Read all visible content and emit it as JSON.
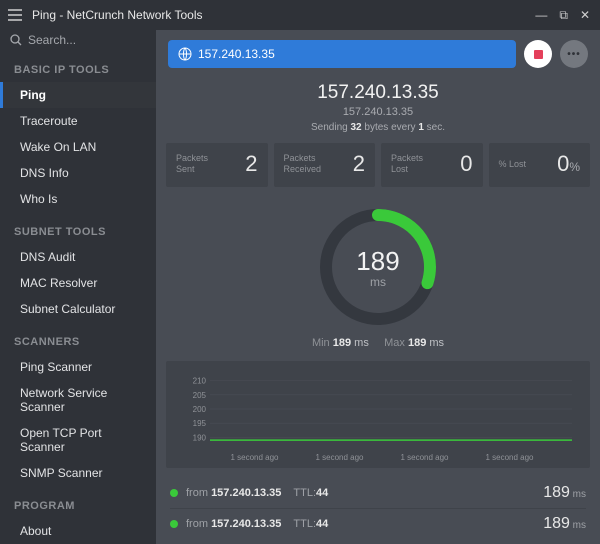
{
  "window": {
    "title": "Ping - NetCrunch Network Tools"
  },
  "search": {
    "placeholder": "Search..."
  },
  "sidebar": {
    "sections": [
      {
        "title": "BASIC IP TOOLS",
        "items": [
          {
            "label": "Ping",
            "active": true
          },
          {
            "label": "Traceroute",
            "active": false
          },
          {
            "label": "Wake On LAN",
            "active": false
          },
          {
            "label": "DNS Info",
            "active": false
          },
          {
            "label": "Who Is",
            "active": false
          }
        ]
      },
      {
        "title": "SUBNET TOOLS",
        "items": [
          {
            "label": "DNS Audit",
            "active": false
          },
          {
            "label": "MAC Resolver",
            "active": false
          },
          {
            "label": "Subnet Calculator",
            "active": false
          }
        ]
      },
      {
        "title": "SCANNERS",
        "items": [
          {
            "label": "Ping Scanner",
            "active": false
          },
          {
            "label": "Network Service Scanner",
            "active": false
          },
          {
            "label": "Open TCP Port Scanner",
            "active": false
          },
          {
            "label": "SNMP Scanner",
            "active": false
          }
        ]
      },
      {
        "title": "PROGRAM",
        "items": [
          {
            "label": "About",
            "active": false
          }
        ]
      }
    ]
  },
  "address": {
    "value": "157.240.13.35"
  },
  "header": {
    "ip_primary": "157.240.13.35",
    "ip_secondary": "157.240.13.35",
    "sending_prefix": "Sending ",
    "sending_bytes": "32",
    "sending_mid": " bytes every ",
    "sending_secs": "1",
    "sending_suffix": " sec."
  },
  "stats": {
    "sent_label": "Packets\nSent",
    "sent_value": "2",
    "recv_label": "Packets\nReceived",
    "recv_value": "2",
    "lost_label": "Packets\nLost",
    "lost_value": "0",
    "pctlost_label": "% Lost",
    "pctlost_value": "0",
    "pct_unit": "%"
  },
  "gauge": {
    "value": "189",
    "unit": "ms"
  },
  "minmax": {
    "min_label": "Min ",
    "min_value": "189",
    "min_unit": " ms",
    "max_label": "Max ",
    "max_value": "189",
    "max_unit": " ms"
  },
  "chart_data": {
    "type": "line",
    "x": [
      "1 second ago",
      "1 second ago",
      "1 second ago",
      "1 second ago"
    ],
    "series": [
      {
        "name": "latency_ms",
        "values": [
          189,
          189,
          189,
          189
        ]
      }
    ],
    "y_ticks": [
      190,
      195,
      200,
      205,
      210
    ],
    "ylim": [
      188,
      212
    ],
    "title": "",
    "xlabel": "",
    "ylabel": ""
  },
  "log": [
    {
      "from_label": "from ",
      "ip": "157.240.13.35",
      "ttl_label": "TTL:",
      "ttl": "44",
      "ms": "189",
      "ms_unit": " ms"
    },
    {
      "from_label": "from ",
      "ip": "157.240.13.35",
      "ttl_label": "TTL:",
      "ttl": "44",
      "ms": "189",
      "ms_unit": " ms"
    }
  ],
  "colors": {
    "accent": "#2f7bd9",
    "green": "#3ac93a",
    "stop": "#e43f5a"
  }
}
